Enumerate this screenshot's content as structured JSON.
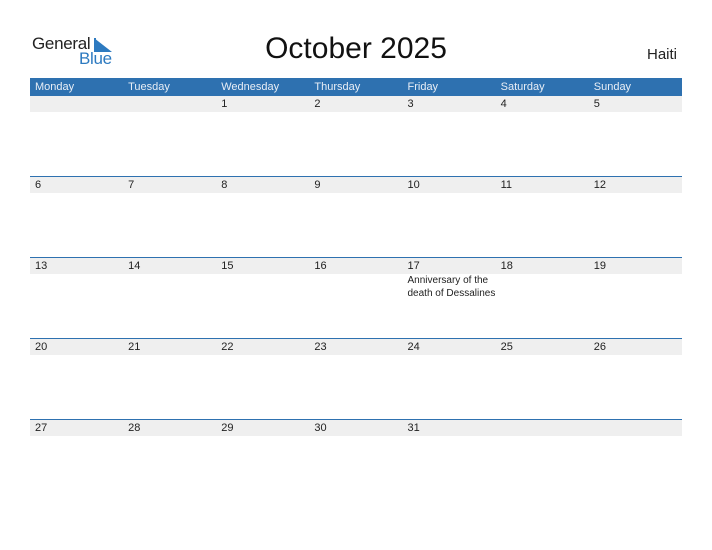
{
  "logo": {
    "general": "General",
    "blue": "Blue"
  },
  "title": "October 2025",
  "country": "Haiti",
  "weekdays": [
    "Monday",
    "Tuesday",
    "Wednesday",
    "Thursday",
    "Friday",
    "Saturday",
    "Sunday"
  ],
  "weeks": [
    {
      "days": [
        "",
        "",
        "1",
        "2",
        "3",
        "4",
        "5"
      ],
      "events": [
        "",
        "",
        "",
        "",
        "",
        "",
        ""
      ]
    },
    {
      "days": [
        "6",
        "7",
        "8",
        "9",
        "10",
        "11",
        "12"
      ],
      "events": [
        "",
        "",
        "",
        "",
        "",
        "",
        ""
      ]
    },
    {
      "days": [
        "13",
        "14",
        "15",
        "16",
        "17",
        "18",
        "19"
      ],
      "events": [
        "",
        "",
        "",
        "",
        "Anniversary of the death of Dessalines",
        "",
        ""
      ]
    },
    {
      "days": [
        "20",
        "21",
        "22",
        "23",
        "24",
        "25",
        "26"
      ],
      "events": [
        "",
        "",
        "",
        "",
        "",
        "",
        ""
      ]
    },
    {
      "days": [
        "27",
        "28",
        "29",
        "30",
        "31",
        "",
        ""
      ],
      "events": [
        "",
        "",
        "",
        "",
        "",
        "",
        ""
      ]
    }
  ],
  "colors": {
    "accent": "#2e71b0",
    "band": "#efefef",
    "logo_blue": "#2d7ac0"
  }
}
